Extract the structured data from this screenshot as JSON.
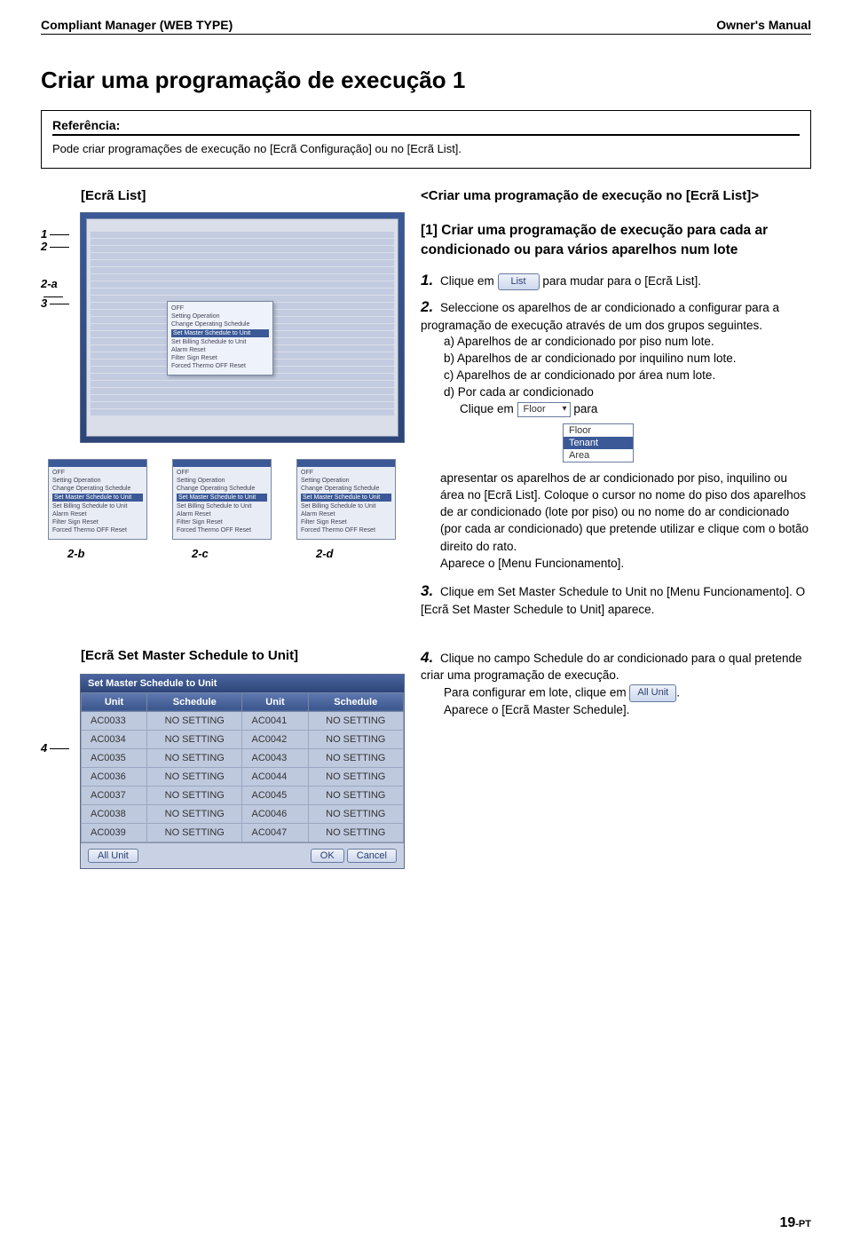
{
  "header": {
    "left": "Compliant Manager (WEB TYPE)",
    "right": "Owner's Manual"
  },
  "title": "Criar uma programação de execução 1",
  "reference": {
    "label": "Referência:",
    "text": "Pode criar programações de execução no [Ecrã Configuração] ou no [Ecrã List]."
  },
  "left": {
    "screen_label": "[Ecrã List]",
    "annos": {
      "a1": "1",
      "a2": "2",
      "a2a": "2-a",
      "a3": "3"
    },
    "mini_labels": {
      "b": "2-b",
      "c": "2-c",
      "d": "2-d"
    },
    "sms_label": "[Ecrã Set Master Schedule to Unit]",
    "sms_anno": "4",
    "context_menu": [
      "OFF",
      "Setting Operation",
      "Change Operating Schedule",
      "Set Master Schedule to Unit",
      "Set Billing Schedule to Unit",
      "Alarm Reset",
      "Filter Sign Reset",
      "Forced Thermo OFF Reset"
    ],
    "context_menu_hl_index": 3
  },
  "right": {
    "heading": "<Criar uma programação de execução no [Ecrã List]>",
    "section": "[1]  Criar uma programação de execução para cada ar condicionado ou para vários aparelhos num lote",
    "s1_num": "1.",
    "s1a": "Clique em",
    "s1_btn": "List",
    "s1b": "para mudar para o [Ecrã List].",
    "s2_num": "2.",
    "s2": "Seleccione os aparelhos de ar condicionado a configurar para a programação de execução através de um dos grupos seguintes.",
    "s2a": "a) Aparelhos de ar condicionado por piso num lote.",
    "s2b": "b) Aparelhos de ar condicionado por inquilino num lote.",
    "s2c": "c) Aparelhos de ar condicionado por área num lote.",
    "s2d": "d) Por cada  ar condicionado",
    "s2d_click": "Clique em",
    "s2d_sel": "Floor",
    "s2d_para": "para",
    "dropdown_opts": [
      "Floor",
      "Tenant",
      "Area"
    ],
    "dropdown_sel_index": 1,
    "para1": "apresentar os aparelhos de ar condicionado por piso, inquilino ou área no [Ecrã List]. Coloque o cursor no nome do piso dos aparelhos de ar condicionado (lote por piso) ou no nome do ar condicionado (por cada ar condicionado) que pretende utilizar e clique com o botão direito do rato.",
    "para1b": "Aparece o [Menu Funcionamento].",
    "s3_num": "3.",
    "s3": "Clique em Set Master Schedule to Unit no [Menu Funcionamento]. O [Ecrã Set Master Schedule to Unit] aparece.",
    "s4_num": "4.",
    "s4a": "Clique no campo Schedule do ar condicionado para o qual pretende criar uma programação de execução.",
    "s4b_pre": "Para configurar em lote, clique em",
    "s4b_btn": "All Unit",
    "s4b_post": ".",
    "s4c": "Aparece o [Ecrã Master Schedule]."
  },
  "sms": {
    "title": "Set Master Schedule to Unit",
    "cols": [
      "Unit",
      "Schedule",
      "Unit",
      "Schedule"
    ],
    "rows": [
      [
        "AC0033",
        "NO SETTING",
        "AC0041",
        "NO SETTING"
      ],
      [
        "AC0034",
        "NO SETTING",
        "AC0042",
        "NO SETTING"
      ],
      [
        "AC0035",
        "NO SETTING",
        "AC0043",
        "NO SETTING"
      ],
      [
        "AC0036",
        "NO SETTING",
        "AC0044",
        "NO SETTING"
      ],
      [
        "AC0037",
        "NO SETTING",
        "AC0045",
        "NO SETTING"
      ],
      [
        "AC0038",
        "NO SETTING",
        "AC0046",
        "NO SETTING"
      ],
      [
        "AC0039",
        "NO SETTING",
        "AC0047",
        "NO SETTING"
      ]
    ],
    "footer": {
      "allunit": "All Unit",
      "ok": "OK",
      "cancel": "Cancel"
    }
  },
  "pageno": {
    "num": "19",
    "suf": "-PT"
  }
}
